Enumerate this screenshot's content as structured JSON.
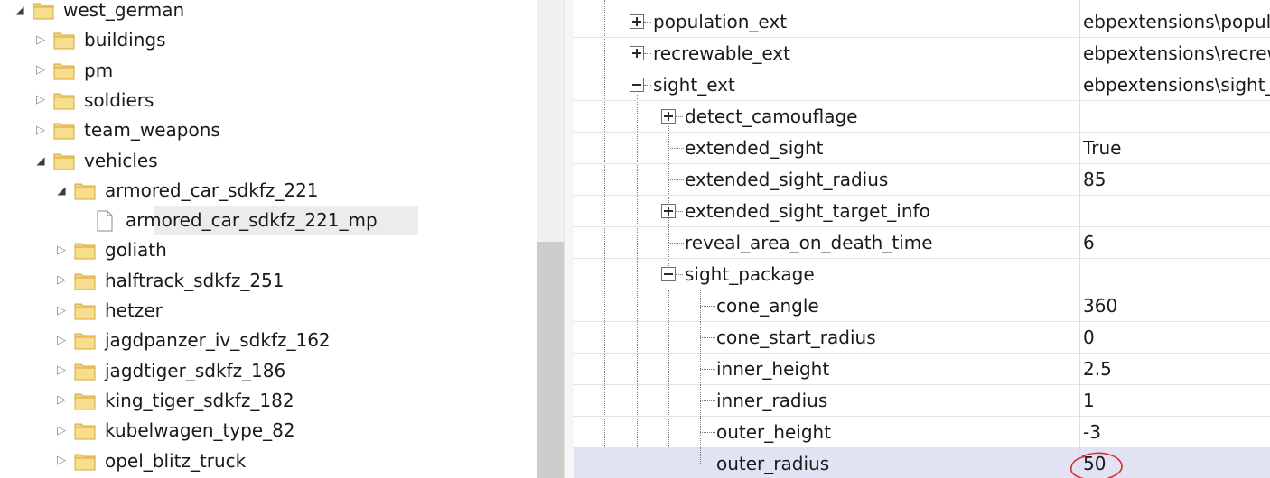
{
  "tree": {
    "items": [
      {
        "label": "west_german",
        "indent": 0,
        "state": "expanded",
        "icon": "folder-icon"
      },
      {
        "label": "buildings",
        "indent": 1,
        "state": "collapsed",
        "icon": "folder-icon"
      },
      {
        "label": "pm",
        "indent": 1,
        "state": "collapsed",
        "icon": "folder-icon"
      },
      {
        "label": "soldiers",
        "indent": 1,
        "state": "collapsed",
        "icon": "folder-icon"
      },
      {
        "label": "team_weapons",
        "indent": 1,
        "state": "collapsed",
        "icon": "folder-icon"
      },
      {
        "label": "vehicles",
        "indent": 1,
        "state": "expanded",
        "icon": "folder-icon"
      },
      {
        "label": "armored_car_sdkfz_221",
        "indent": 2,
        "state": "expanded",
        "icon": "folder-icon"
      },
      {
        "label": "armored_car_sdkfz_221_mp",
        "indent": 3,
        "state": "none",
        "icon": "file-icon",
        "selected": true
      },
      {
        "label": "goliath",
        "indent": 2,
        "state": "collapsed",
        "icon": "folder-icon"
      },
      {
        "label": "halftrack_sdkfz_251",
        "indent": 2,
        "state": "collapsed",
        "icon": "folder-icon"
      },
      {
        "label": "hetzer",
        "indent": 2,
        "state": "collapsed",
        "icon": "folder-icon"
      },
      {
        "label": "jagdpanzer_iv_sdkfz_162",
        "indent": 2,
        "state": "collapsed",
        "icon": "folder-icon"
      },
      {
        "label": "jagdtiger_sdkfz_186",
        "indent": 2,
        "state": "collapsed",
        "icon": "folder-icon"
      },
      {
        "label": "king_tiger_sdkfz_182",
        "indent": 2,
        "state": "collapsed",
        "icon": "folder-icon"
      },
      {
        "label": "kubelwagen_type_82",
        "indent": 2,
        "state": "collapsed",
        "icon": "folder-icon"
      },
      {
        "label": "opel_blitz_truck",
        "indent": 2,
        "state": "collapsed",
        "icon": "folder-icon"
      }
    ]
  },
  "properties": {
    "rows": [
      {
        "name": "population_ext",
        "value": "ebpextensions\\population_ext",
        "level": 0,
        "expander": "plus"
      },
      {
        "name": "recrewable_ext",
        "value": "ebpextensions\\recrewable_ext",
        "level": 0,
        "expander": "plus"
      },
      {
        "name": "sight_ext",
        "value": "ebpextensions\\sight_ext",
        "level": 0,
        "expander": "minus"
      },
      {
        "name": "detect_camouflage",
        "value": "",
        "level": 1,
        "expander": "plus"
      },
      {
        "name": "extended_sight",
        "value": "True",
        "level": 1,
        "expander": "none"
      },
      {
        "name": "extended_sight_radius",
        "value": "85",
        "level": 1,
        "expander": "none"
      },
      {
        "name": "extended_sight_target_info",
        "value": "",
        "level": 1,
        "expander": "plus"
      },
      {
        "name": "reveal_area_on_death_time",
        "value": "6",
        "level": 1,
        "expander": "none"
      },
      {
        "name": "sight_package",
        "value": "",
        "level": 1,
        "expander": "minus"
      },
      {
        "name": "cone_angle",
        "value": "360",
        "level": 2,
        "expander": "none"
      },
      {
        "name": "cone_start_radius",
        "value": "0",
        "level": 2,
        "expander": "none"
      },
      {
        "name": "inner_height",
        "value": "2.5",
        "level": 2,
        "expander": "none"
      },
      {
        "name": "inner_radius",
        "value": "1",
        "level": 2,
        "expander": "none"
      },
      {
        "name": "outer_height",
        "value": "-3",
        "level": 2,
        "expander": "none"
      },
      {
        "name": "outer_radius",
        "value": "50",
        "level": 2,
        "expander": "none",
        "selected": true,
        "annotated": true
      }
    ]
  },
  "colors": {
    "folder_fill": "#f3d37a",
    "folder_stroke": "#d7a938",
    "selected_row": "#e1e3f3",
    "annotation": "#d93030"
  }
}
